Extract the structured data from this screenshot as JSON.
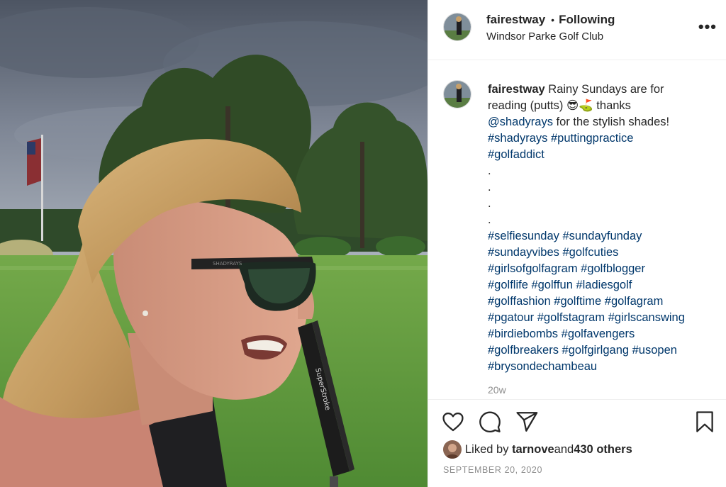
{
  "post": {
    "username": "fairestway",
    "follow_status": "Following",
    "separator": "•",
    "location": "Windsor Parke Golf Club",
    "more_label": "•••"
  },
  "photo": {
    "sunglasses_brand": "SHADYRAYS",
    "grip_brand": "SuperStroke"
  },
  "caption": {
    "username": "fairestway",
    "text1": " Rainy Sundays are for",
    "text2": "reading (putts) 😎⛳ thanks",
    "mention": "@shadyrays",
    "text3": " for the stylish shades!",
    "tags_a": [
      "#shadyrays #puttingpractice",
      "#golfaddict"
    ],
    "dots": [
      ".",
      ".",
      ".",
      "."
    ],
    "tags_b": [
      "#selfiesunday #sundayfunday",
      "#sundayvibes #golfcuties",
      "#girlsofgolfagram #golfblogger",
      "#golflife #golffun #ladiesgolf",
      "#golffashion #golftime #golfagram",
      "#pgatour #golfstagram #girlscanswing",
      "#birdiebombs #golfavengers",
      "#golfbreakers #golfgirlgang #usopen",
      "#brysondechambeau"
    ],
    "time_ago": "20w"
  },
  "likes": {
    "prefix": "Liked by ",
    "user": "tarnove",
    "middle": " and ",
    "others": "430 others"
  },
  "date": "SEPTEMBER 20, 2020",
  "icons": [
    "heart-icon",
    "comment-icon",
    "share-icon",
    "bookmark-icon"
  ]
}
